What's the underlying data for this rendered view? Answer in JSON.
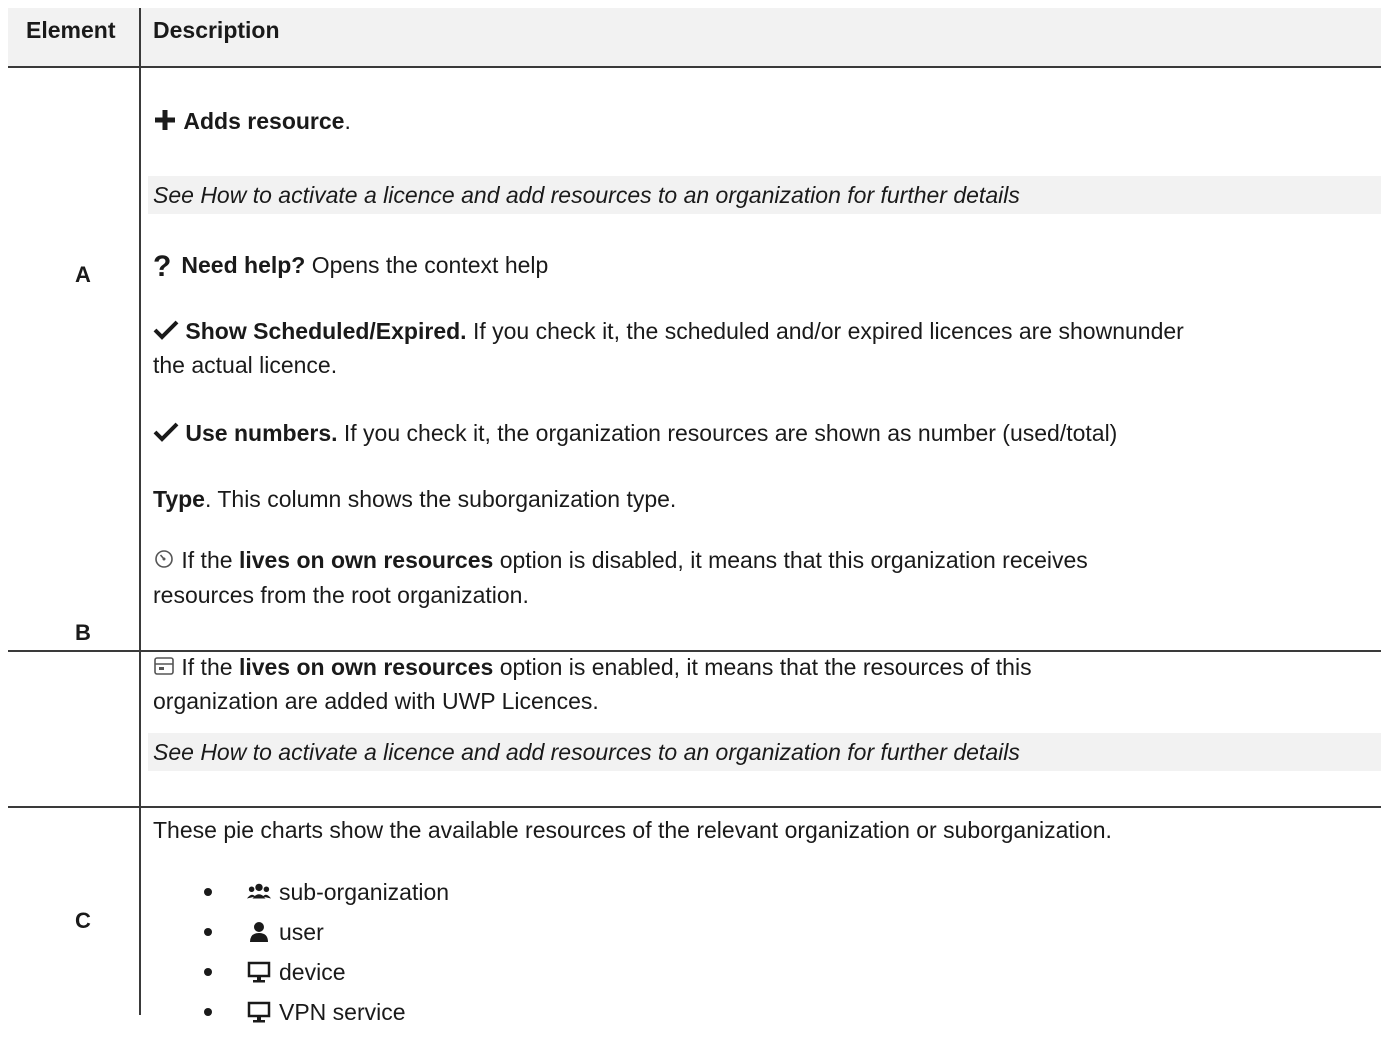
{
  "header": {
    "element": "Element",
    "description": "Description"
  },
  "row_a": {
    "letter": "A",
    "adds_label": "Adds resource",
    "adds_suffix": ".",
    "see_note": "See How to activate a licence and add resources to an organization for further details",
    "help_label": "Need help?",
    "help_text": " Opens the context help",
    "sched_label": "Show Scheduled/Expired.",
    "sched_text_1": " If you check it, the scheduled and/or expired licences are shownunder",
    "sched_text_2": "the actual licence.",
    "numbers_label": "Use numbers.",
    "numbers_text": " If you check it, the organization resources are shown as number (used/total)",
    "icons": {
      "add": "plus-icon",
      "help": "question-mark-icon",
      "check": "checkmark-icon"
    }
  },
  "row_b": {
    "letter": "B",
    "type_label": "Type",
    "type_text": ". This column shows the suborganization type.",
    "disabled_pre": " If the ",
    "disabled_bold": "lives on own resources",
    "disabled_post": " option is disabled, it means that this organization receives",
    "disabled_line2": "resources from the root organization.",
    "enabled_pre": "  If the ",
    "enabled_bold": "lives on own resources",
    "enabled_post": " option is enabled, it means that the resources of this",
    "enabled_line2": "organization are added with UWP Licences.",
    "see_note": "See How to activate a licence and add resources to an organization for further details",
    "icons": {
      "disabled": "gauge-icon",
      "enabled": "box-icon"
    }
  },
  "row_c": {
    "letter": "C",
    "intro": "These pie charts show the available resources of the relevant organization or suborganization.",
    "items": [
      {
        "icon": "users-icon",
        "label": "sub-organization"
      },
      {
        "icon": "user-icon",
        "label": "user"
      },
      {
        "icon": "monitor-icon",
        "label": "device"
      },
      {
        "icon": "monitor-icon",
        "label": "VPN service"
      }
    ]
  }
}
